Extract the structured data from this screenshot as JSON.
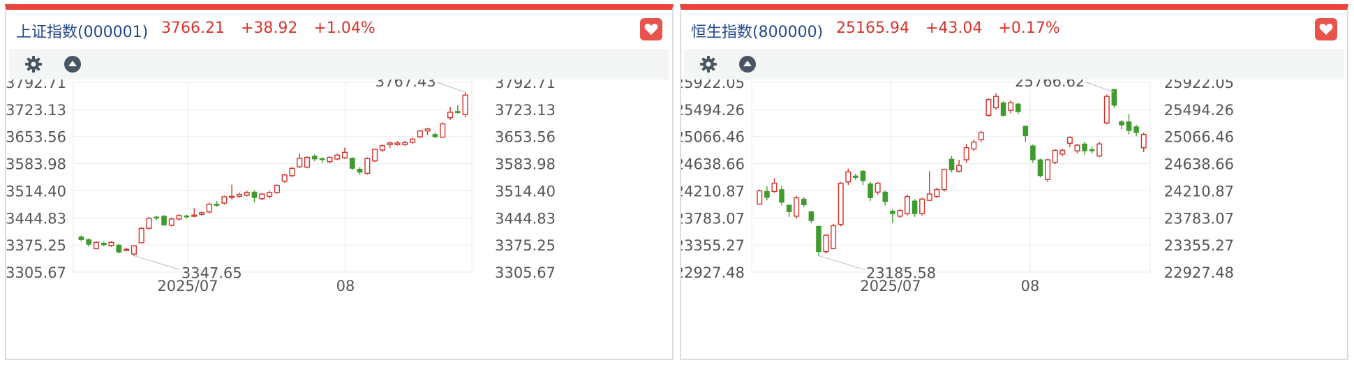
{
  "colors": {
    "up": "#d4302a",
    "down": "#3f9b2c",
    "accent": "#e8413a",
    "title": "#234a8c",
    "grid": "#e8eaed",
    "text": "#555555"
  },
  "panels": [
    {
      "name": "上证指数(000001)",
      "price": "3766.21",
      "change": "+38.92",
      "pct": "+1.04%",
      "yticks": [
        "3792.71",
        "3723.13",
        "3653.56",
        "3583.98",
        "3514.40",
        "3444.83",
        "3375.25",
        "3305.67"
      ],
      "xticks": [
        "2025/07",
        "08"
      ],
      "max_label": "3767.43",
      "min_label": "3347.65"
    },
    {
      "name": "恒生指数(800000)",
      "price": "25165.94",
      "change": "+43.04",
      "pct": "+0.17%",
      "yticks": [
        "25922.05",
        "25494.26",
        "25066.46",
        "24638.66",
        "24210.87",
        "23783.07",
        "23355.27",
        "22927.48"
      ],
      "xticks": [
        "2025/07",
        "08"
      ],
      "max_label": "25766.62",
      "min_label": "23185.58"
    }
  ],
  "chart_data": [
    {
      "type": "candlestick",
      "title": "上证指数(000001)",
      "ylim": [
        3305.67,
        3792.71
      ],
      "x_ticks": [
        "2025/07",
        "08"
      ],
      "grid": true,
      "candles": [
        [
          3396,
          3389,
          3400,
          3385
        ],
        [
          3389,
          3377,
          3392,
          3371
        ],
        [
          3366,
          3382,
          3385,
          3364
        ],
        [
          3380,
          3376,
          3384,
          3372
        ],
        [
          3374,
          3382,
          3385,
          3370
        ],
        [
          3375,
          3357,
          3378,
          3354
        ],
        [
          3363,
          3364,
          3368,
          3359
        ],
        [
          3352,
          3373,
          3375,
          3347.65
        ],
        [
          3381,
          3418,
          3420,
          3380
        ],
        [
          3418,
          3444,
          3447,
          3416
        ],
        [
          3447,
          3445,
          3450,
          3439
        ],
        [
          3449,
          3427,
          3452,
          3424
        ],
        [
          3426,
          3442,
          3446,
          3423
        ],
        [
          3442,
          3451,
          3455,
          3438
        ],
        [
          3450,
          3448,
          3453,
          3443
        ],
        [
          3449,
          3452,
          3470,
          3447
        ],
        [
          3454,
          3458,
          3462,
          3450
        ],
        [
          3460,
          3480,
          3484,
          3456
        ],
        [
          3480,
          3477,
          3488,
          3473
        ],
        [
          3483,
          3499,
          3502,
          3479
        ],
        [
          3500,
          3500,
          3530,
          3492
        ],
        [
          3500,
          3505,
          3510,
          3497
        ],
        [
          3503,
          3510,
          3514,
          3500
        ],
        [
          3511,
          3497,
          3515,
          3485
        ],
        [
          3494,
          3506,
          3509,
          3490
        ],
        [
          3500,
          3510,
          3514,
          3495
        ],
        [
          3510,
          3528,
          3531,
          3507
        ],
        [
          3539,
          3555,
          3558,
          3535
        ],
        [
          3553,
          3572,
          3575,
          3550
        ],
        [
          3576,
          3598,
          3610,
          3573
        ],
        [
          3575,
          3600,
          3603,
          3572
        ],
        [
          3603,
          3596,
          3608,
          3590
        ],
        [
          3597,
          3595,
          3600,
          3586
        ],
        [
          3589,
          3600,
          3603,
          3585
        ],
        [
          3596,
          3606,
          3609,
          3593
        ],
        [
          3599,
          3613,
          3625,
          3596
        ],
        [
          3598,
          3572,
          3600,
          3567
        ],
        [
          3570,
          3562,
          3575,
          3555
        ],
        [
          3559,
          3597,
          3600,
          3556
        ],
        [
          3591,
          3621,
          3623,
          3588
        ],
        [
          3619,
          3630,
          3633,
          3614
        ],
        [
          3633,
          3637,
          3641,
          3624
        ],
        [
          3633,
          3637,
          3642,
          3630
        ],
        [
          3633,
          3638,
          3642,
          3629
        ],
        [
          3639,
          3647,
          3651,
          3635
        ],
        [
          3653,
          3668,
          3670,
          3650
        ],
        [
          3668,
          3673,
          3676,
          3658
        ],
        [
          3659,
          3653,
          3664,
          3650
        ],
        [
          3652,
          3686,
          3690,
          3650
        ],
        [
          3702,
          3716,
          3730,
          3696
        ],
        [
          3718,
          3715,
          3734,
          3712
        ],
        [
          3710,
          3760,
          3767.43,
          3703
        ]
      ]
    },
    {
      "type": "candlestick",
      "title": "恒生指数(800000)",
      "ylim": [
        22927.48,
        25922.05
      ],
      "x_ticks": [
        "2025/07",
        "08"
      ],
      "grid": true,
      "candles": [
        [
          24000,
          24210,
          24230,
          23990
        ],
        [
          24200,
          24105,
          24280,
          24060
        ],
        [
          24200,
          24330,
          24410,
          24180
        ],
        [
          24230,
          24030,
          24290,
          23980
        ],
        [
          23985,
          23880,
          23990,
          23800
        ],
        [
          23810,
          24100,
          24130,
          23770
        ],
        [
          24080,
          23990,
          24110,
          23950
        ],
        [
          23880,
          23740,
          23890,
          23700
        ],
        [
          23650,
          23250,
          23660,
          23185.58
        ],
        [
          23250,
          23510,
          23520,
          23220
        ],
        [
          23300,
          23660,
          23690,
          23290
        ],
        [
          23680,
          24330,
          24350,
          23650
        ],
        [
          24350,
          24510,
          24560,
          24300
        ],
        [
          24445,
          24420,
          24480,
          24380
        ],
        [
          24520,
          24370,
          24540,
          24300
        ],
        [
          24320,
          24100,
          24350,
          24050
        ],
        [
          24190,
          24330,
          24350,
          24150
        ],
        [
          24190,
          24040,
          24220,
          23980
        ],
        [
          23890,
          23850,
          23920,
          23700
        ],
        [
          23810,
          23900,
          23920,
          23780
        ],
        [
          23850,
          24120,
          24150,
          23820
        ],
        [
          24050,
          23850,
          24080,
          23800
        ],
        [
          23850,
          24080,
          24100,
          23820
        ],
        [
          24060,
          24160,
          24520,
          24050
        ],
        [
          24120,
          24230,
          24260,
          24100
        ],
        [
          24230,
          24550,
          24560,
          24200
        ],
        [
          24710,
          24540,
          24760,
          24500
        ],
        [
          24520,
          24610,
          24700,
          24500
        ],
        [
          24700,
          24890,
          24950,
          24650
        ],
        [
          24870,
          24980,
          25020,
          24840
        ],
        [
          25020,
          25130,
          25160,
          24980
        ],
        [
          25400,
          25650,
          25670,
          25380
        ],
        [
          25520,
          25700,
          25750,
          25490
        ],
        [
          25600,
          25400,
          25620,
          25380
        ],
        [
          25480,
          25600,
          25640,
          25430
        ],
        [
          25580,
          25460,
          25600,
          25420
        ],
        [
          25230,
          25080,
          25240,
          24980
        ],
        [
          24920,
          24700,
          24940,
          24650
        ],
        [
          24700,
          24450,
          24720,
          24420
        ],
        [
          24390,
          24700,
          24710,
          24350
        ],
        [
          24660,
          24850,
          24870,
          24630
        ],
        [
          24790,
          24850,
          24870,
          24760
        ],
        [
          24960,
          25050,
          25070,
          24900
        ],
        [
          24840,
          24930,
          24950,
          24800
        ],
        [
          24950,
          24840,
          24980,
          24780
        ],
        [
          24860,
          24840,
          24900,
          24800
        ],
        [
          24760,
          24950,
          24980,
          24740
        ],
        [
          25280,
          25700,
          25730,
          25260
        ],
        [
          25810,
          25560,
          25766.62,
          25520
        ],
        [
          25300,
          25250,
          25330,
          25180
        ],
        [
          25300,
          25160,
          25420,
          25100
        ],
        [
          25220,
          25130,
          25250,
          25070
        ],
        [
          24890,
          25100,
          25130,
          24820
        ]
      ]
    }
  ]
}
